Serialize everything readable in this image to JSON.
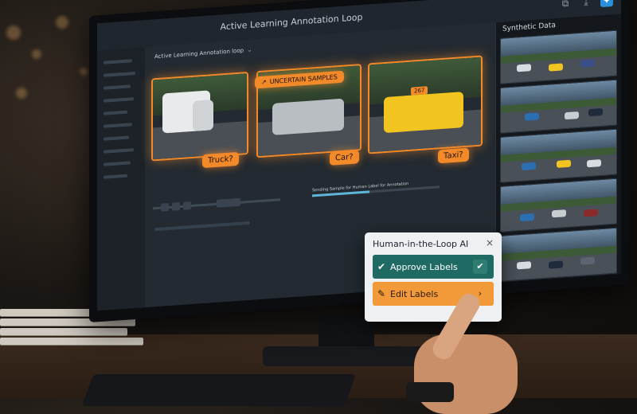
{
  "window": {
    "title": "Active Learning Annotation Loop",
    "tabs": [
      "",
      ""
    ]
  },
  "main": {
    "breadcrumb": "Active Learning Annotation loop",
    "uncertain_badge": "UNCERTAIN SAMPLES",
    "cards": [
      {
        "label": "Truck?"
      },
      {
        "label": "Car?"
      },
      {
        "label": "Taxi?",
        "plate": "267"
      }
    ],
    "status_text": "Sending Sample for Human Label for Annotation"
  },
  "right_panel": {
    "title": "Synthetic Data"
  },
  "popup": {
    "title": "Human-in-the-Loop AI",
    "close": "×",
    "approve_label": "Approve Labels",
    "edit_label": "Edit Labels"
  },
  "colors": {
    "accent_orange": "#f28a2a",
    "approve_teal": "#1f6a62",
    "edit_orange": "#f29a3a",
    "system_blue": "#2a8fd8"
  },
  "icons": {
    "uncertain": "up-arrow-icon",
    "approve": "check-icon",
    "edit": "pencil-icon",
    "window_1": "copy-icon",
    "window_2": "download-icon",
    "window_3": "pin-icon"
  }
}
